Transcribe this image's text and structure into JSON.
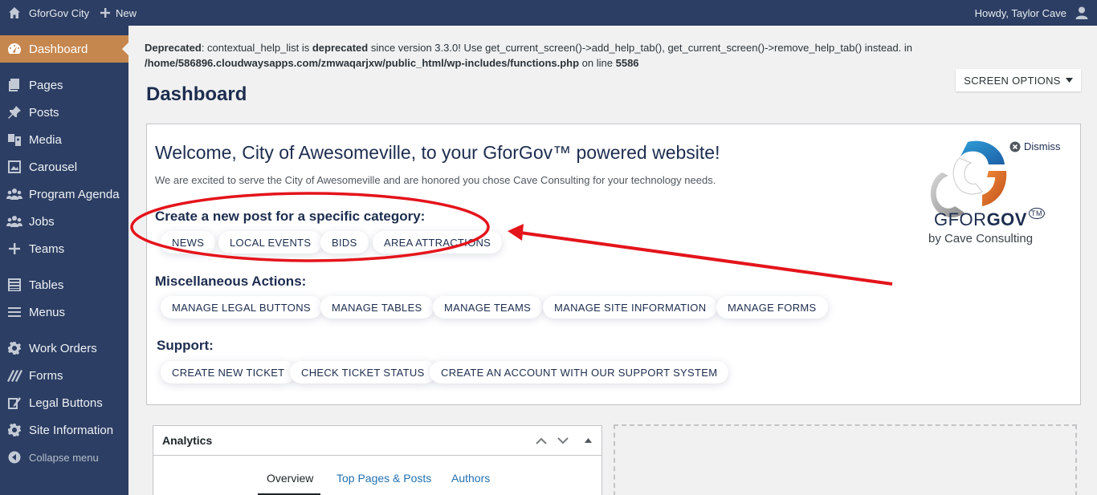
{
  "adminbar": {
    "site_name": "GforGov City",
    "new_label": "New",
    "greeting": "Howdy, Taylor Cave"
  },
  "sidebar": {
    "items": [
      {
        "label": "Dashboard",
        "icon": "dashboard-icon",
        "active": true
      },
      {
        "label": "Pages",
        "icon": "pages-icon"
      },
      {
        "label": "Posts",
        "icon": "pin-icon"
      },
      {
        "label": "Media",
        "icon": "media-icon"
      },
      {
        "label": "Carousel",
        "icon": "gallery-icon"
      },
      {
        "label": "Program Agenda",
        "icon": "groups-icon"
      },
      {
        "label": "Jobs",
        "icon": "groups-icon"
      },
      {
        "label": "Teams",
        "icon": "plus-icon"
      },
      {
        "label": "Tables",
        "icon": "table-icon"
      },
      {
        "label": "Menus",
        "icon": "menu-icon"
      },
      {
        "label": "Work Orders",
        "icon": "gear-icon"
      },
      {
        "label": "Forms",
        "icon": "forms-icon"
      },
      {
        "label": "Legal Buttons",
        "icon": "edit-page-icon"
      },
      {
        "label": "Site Information",
        "icon": "gear-icon"
      },
      {
        "label": "Collapse menu",
        "icon": "collapse-icon"
      }
    ]
  },
  "notice": {
    "prefix": "Deprecated",
    "text1": ": contextual_help_list is ",
    "deprecated": "deprecated",
    "text2": " since version 3.3.0! Use get_current_screen()->add_help_tab(), get_current_screen()->remove_help_tab() instead. in",
    "path": "/home/586896.cloudwaysapps.com/zmwaqarjxw/public_html/wp-includes/functions.php",
    "online": " on line ",
    "line": "5586"
  },
  "screen_options": "SCREEN OPTIONS",
  "page_title": "Dashboard",
  "welcome": {
    "title": "Welcome, City of Awesomeville, to your GforGov™ powered website!",
    "subtitle": "We are excited to serve the City of Awesomeville and are honored you chose Cave Consulting for your technology needs.",
    "dismiss": "Dismiss",
    "logo_text_light": "GFOR",
    "logo_text_bold": "GOV",
    "logo_tm": "TM",
    "logo_sub": "by Cave Consulting",
    "create_heading": "Create a new post for a specific category:",
    "create_buttons": [
      "NEWS",
      "LOCAL EVENTS",
      "BIDS",
      "AREA ATTRACTIONS"
    ],
    "misc_heading": "Miscellaneous Actions:",
    "misc_buttons": [
      "MANAGE LEGAL BUTTONS",
      "MANAGE TABLES",
      "MANAGE TEAMS",
      "MANAGE SITE INFORMATION",
      "MANAGE FORMS"
    ],
    "support_heading": "Support:",
    "support_buttons": [
      "CREATE NEW TICKET",
      "CHECK TICKET STATUS",
      "CREATE AN ACCOUNT WITH OUR SUPPORT SYSTEM"
    ]
  },
  "analytics": {
    "title": "Analytics",
    "tabs": [
      "Overview",
      "Top Pages & Posts",
      "Authors"
    ]
  },
  "colors": {
    "admin_bg": "#2c3e63",
    "active_menu": "#c6874f",
    "annotation_red": "#e4141b",
    "link_blue": "#2271b1"
  }
}
